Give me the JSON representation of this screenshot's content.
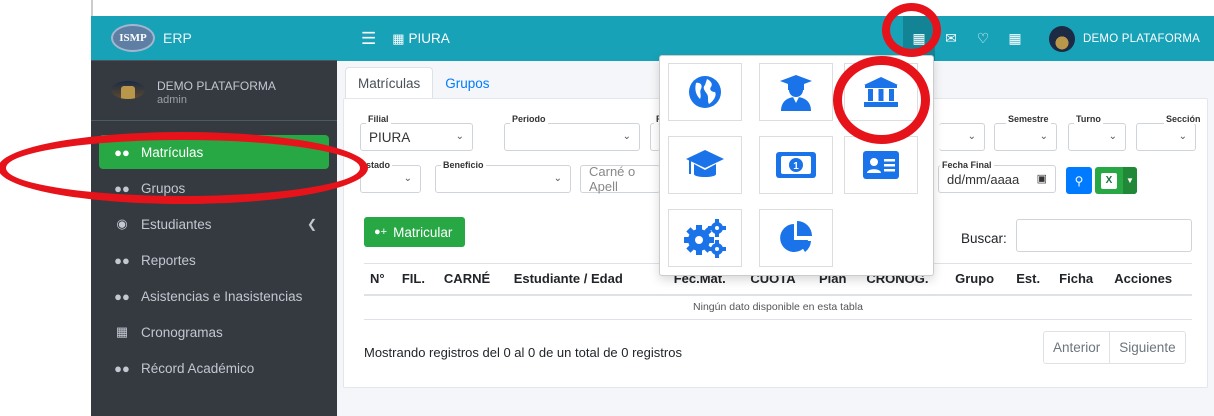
{
  "brand": {
    "logo_text": "ISMP",
    "name": "ERP"
  },
  "user": {
    "name": "DEMO PLATAFORMA",
    "role": "admin"
  },
  "sidebar": {
    "items": [
      {
        "label": "Matrículas",
        "icon": "users-icon"
      },
      {
        "label": "Grupos",
        "icon": "users-icon"
      },
      {
        "label": "Estudiantes",
        "icon": "eye-icon"
      },
      {
        "label": "Reportes",
        "icon": "users-icon"
      },
      {
        "label": "Asistencias e Inasistencias",
        "icon": "users-icon"
      },
      {
        "label": "Cronogramas",
        "icon": "calendar-icon"
      },
      {
        "label": "Récord Académico",
        "icon": "users-icon"
      }
    ]
  },
  "header": {
    "office": "PIURA",
    "top_user": "DEMO PLATAFORMA"
  },
  "tabs": [
    {
      "label": "Matrículas"
    },
    {
      "label": "Grupos"
    }
  ],
  "filters": {
    "filial_label": "Filial",
    "filial_value": "PIURA",
    "periodo_label": "Periodo",
    "p_label": "P",
    "semestre_label": "Semestre",
    "turno_label": "Turno",
    "seccion_label": "Sección",
    "estado_label": "stado",
    "beneficio_label": "Beneficio",
    "search_placeholder": "Carné o Apell",
    "fecha_final_label": "Fecha Final",
    "fecha_final_value": "dd/mm/aaaa"
  },
  "actions": {
    "matricular": "Matricular",
    "buscar_label": "Buscar:"
  },
  "table": {
    "columns": [
      "N°",
      "FIL.",
      "CARNÉ",
      "Estudiante / Edad",
      "Fec.Mat.",
      "CUOTA",
      "Plan",
      "CRONOG.",
      "Grupo",
      "Est.",
      "Ficha",
      "Acciones"
    ],
    "empty": "Ningún dato disponible en esta tabla"
  },
  "footer": {
    "info": "Mostrando registros del 0 al 0 de un total de 0 registros",
    "prev": "Anterior",
    "next": "Siguiente"
  },
  "apps_menu": {
    "items": [
      "globe-icon",
      "student-icon",
      "institution-icon",
      "graduation-cap-icon",
      "money-bill-icon",
      "id-card-icon",
      "cogs-icon",
      "pie-chart-icon"
    ]
  },
  "colors": {
    "teal": "#17a2b8",
    "sidebar": "#343a40",
    "green": "#28a745",
    "blue": "#007bff",
    "icon_blue": "#1a73e8",
    "highlight_red": "#e6131b"
  }
}
